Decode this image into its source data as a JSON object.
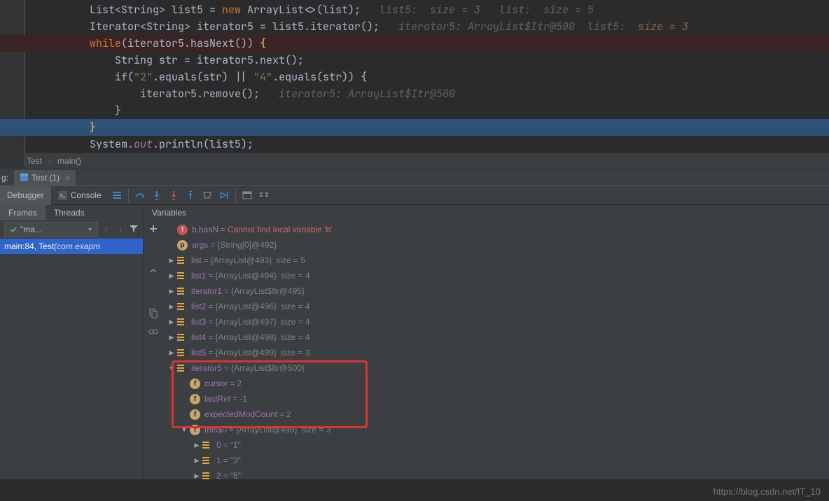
{
  "code": {
    "l1a": "List<String> list5 = ",
    "l1new": "new",
    "l1b": " ArrayList<>(list);",
    "l1hint": "   list5:  size = 3   list:  size = 5",
    "l2a": "Iterator<String> iterator5 = list5.iterator();",
    "l2hint": "   iterator5: ArrayList$Itr@500  list5:  ",
    "l2hint2": "size = 3",
    "l3a": "while",
    "l3b": "(iterator5.hasNext()) ",
    "l3c": "{",
    "l4": "    String str = iterator5.next();",
    "l5a": "    if(",
    "l5s1": "\"2\"",
    "l5b": ".equals(str) || ",
    "l5s2": "\"4\"",
    "l5c": ".equals(str)) {",
    "l6a": "        iterator5.remove();",
    "l6hint": "   iterator5: ArrayList$Itr@500",
    "l7": "    }",
    "l8": "}",
    "l9a": "System.",
    "l9f": "out",
    "l9b": ".println(list5);"
  },
  "breadcrumb": {
    "a": "Test",
    "b": "main()"
  },
  "toolbar": {
    "g": "g:",
    "runTab": "Test (1)"
  },
  "tabs": {
    "debugger": "Debugger",
    "console": "Console"
  },
  "panels": {
    "frames": "Frames",
    "threads": "Threads",
    "variables": "Variables"
  },
  "frames": {
    "thread": "\"ma...",
    "row": "main:84, Test ",
    "rowLoc": "(com.exapm"
  },
  "vars": {
    "errRow": {
      "name": "b.hasN",
      "eq": "= ",
      "msg": "Cannot find local variable 'b'"
    },
    "args": {
      "n": "args",
      "v": "{String[0]@492}"
    },
    "list": {
      "n": "list",
      "v": "{ArrayList@493}",
      "s": "size = 5"
    },
    "list1": {
      "n": "list1",
      "v": "{ArrayList@494}",
      "s": "size = 4"
    },
    "iter1": {
      "n": "iterator1",
      "v": "{ArrayList$Itr@495}"
    },
    "list2": {
      "n": "list2",
      "v": "{ArrayList@496}",
      "s": "size = 4"
    },
    "list3": {
      "n": "list3",
      "v": "{ArrayList@497}",
      "s": "size = 4"
    },
    "list4": {
      "n": "list4",
      "v": "{ArrayList@498}",
      "s": "size = 4"
    },
    "list5": {
      "n": "list5",
      "v": "{ArrayList@499}",
      "s": "size = 3"
    },
    "iter5": {
      "n": "iterator5",
      "v": "{ArrayList$Itr@500}"
    },
    "cursor": {
      "n": "cursor",
      "v": "2"
    },
    "lastRet": {
      "n": "lastRet",
      "v": "-1"
    },
    "emc": {
      "n": "expectedModCount",
      "v": "2"
    },
    "this0": {
      "n": "this$0",
      "v": "{ArrayList@499}",
      "s": "size = 3"
    },
    "e0": {
      "n": "0",
      "v": "\"1\""
    },
    "e1": {
      "n": "1",
      "v": "\"3\""
    },
    "e2": {
      "n": "2",
      "v": "\"5\""
    }
  },
  "watermark": "https://blog.csdn.net/IT_10"
}
